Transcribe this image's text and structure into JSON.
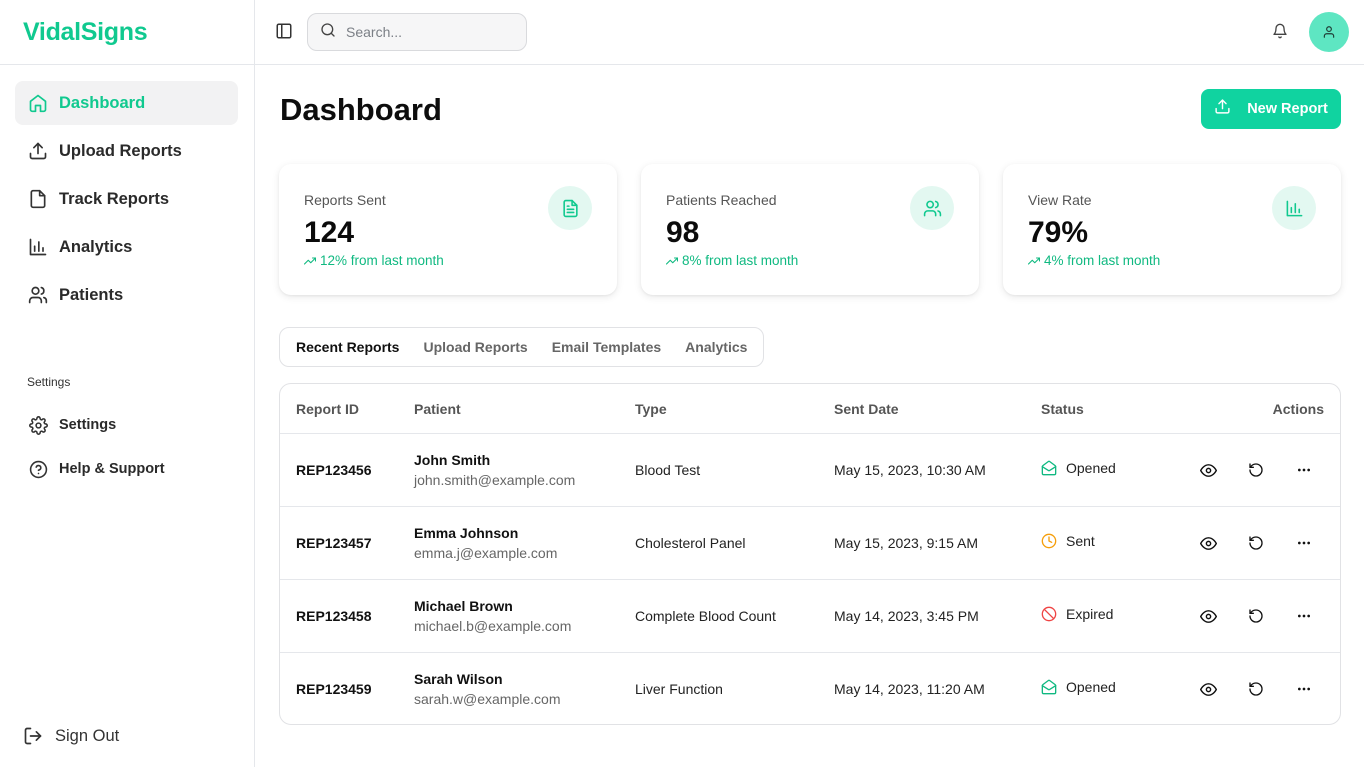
{
  "brand": "VidalSigns",
  "colors": {
    "accent": "#10c98f",
    "button": "#10d3a0",
    "opened": "#10b981",
    "sent": "#f59e0b",
    "expired": "#ef4444"
  },
  "nav": [
    {
      "label": "Dashboard",
      "icon": "home-icon",
      "active": true
    },
    {
      "label": "Upload Reports",
      "icon": "upload-icon"
    },
    {
      "label": "Track Reports",
      "icon": "file-icon"
    },
    {
      "label": "Analytics",
      "icon": "bar-chart-icon"
    },
    {
      "label": "Patients",
      "icon": "users-icon"
    }
  ],
  "settings_section": {
    "heading": "Settings",
    "items": [
      {
        "label": "Settings",
        "icon": "gear-icon"
      },
      {
        "label": "Help & Support",
        "icon": "help-circle-icon"
      }
    ]
  },
  "sign_out": "Sign Out",
  "search": {
    "placeholder": "Search..."
  },
  "page_title": "Dashboard",
  "new_report_label": "New Report",
  "stats": [
    {
      "title": "Reports Sent",
      "value": "124",
      "trend": "12% from last month",
      "icon": "file-text-icon"
    },
    {
      "title": "Patients Reached",
      "value": "98",
      "trend": "8% from last month",
      "icon": "users-icon"
    },
    {
      "title": "View Rate",
      "value": "79%",
      "trend": "4% from last month",
      "icon": "bar-chart-icon"
    }
  ],
  "tabs": [
    {
      "label": "Recent Reports",
      "active": true
    },
    {
      "label": "Upload Reports"
    },
    {
      "label": "Email Templates"
    },
    {
      "label": "Analytics"
    }
  ],
  "table": {
    "headers": {
      "id": "Report ID",
      "patient": "Patient",
      "type": "Type",
      "date": "Sent Date",
      "status": "Status",
      "actions": "Actions"
    },
    "rows": [
      {
        "id": "REP123456",
        "name": "John Smith",
        "email": "john.smith@example.com",
        "type": "Blood Test",
        "date": "May 15, 2023, 10:30 AM",
        "status": "Opened"
      },
      {
        "id": "REP123457",
        "name": "Emma Johnson",
        "email": "emma.j@example.com",
        "type": "Cholesterol Panel",
        "date": "May 15, 2023, 9:15 AM",
        "status": "Sent"
      },
      {
        "id": "REP123458",
        "name": "Michael Brown",
        "email": "michael.b@example.com",
        "type": "Complete Blood Count",
        "date": "May 14, 2023, 3:45 PM",
        "status": "Expired"
      },
      {
        "id": "REP123459",
        "name": "Sarah Wilson",
        "email": "sarah.w@example.com",
        "type": "Liver Function",
        "date": "May 14, 2023, 11:20 AM",
        "status": "Opened"
      }
    ]
  }
}
